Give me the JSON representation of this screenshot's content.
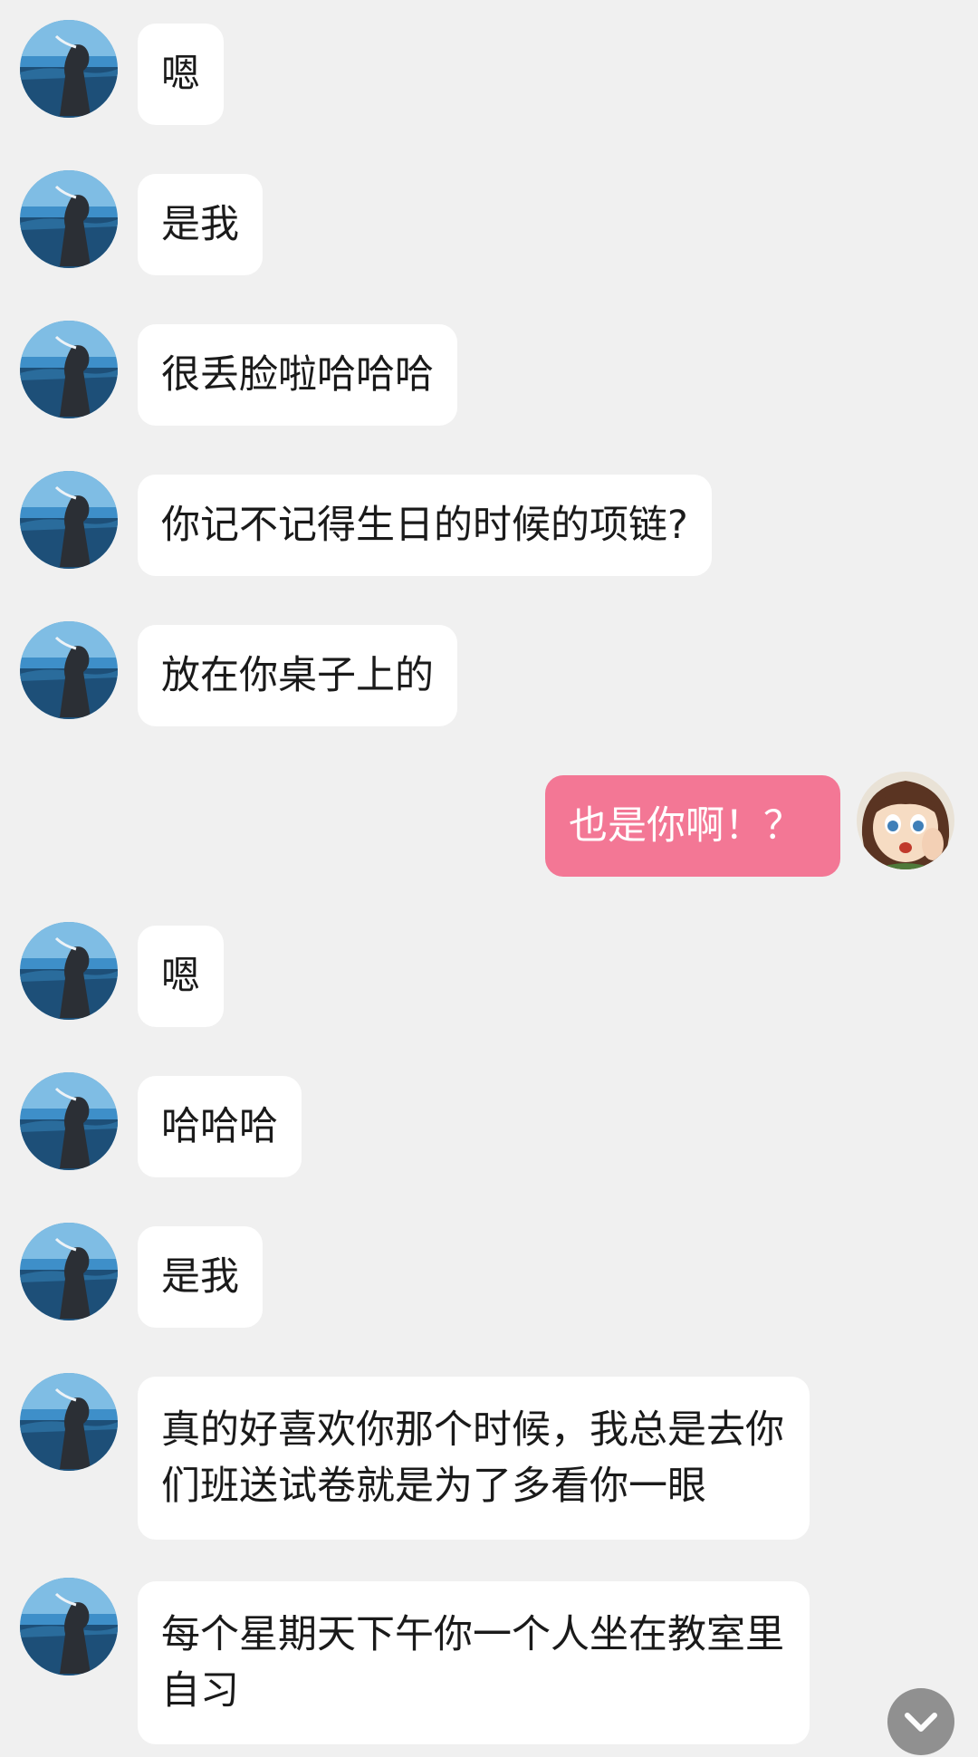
{
  "colors": {
    "background": "#f0f0f0",
    "incoming_bubble": "#ffffff",
    "outgoing_bubble": "#f37795",
    "outgoing_text": "#ffffff",
    "scroll_button": "#888888"
  },
  "messages": [
    {
      "side": "incoming",
      "text": "嗯"
    },
    {
      "side": "incoming",
      "text": "是我"
    },
    {
      "side": "incoming",
      "text": "很丢脸啦哈哈哈"
    },
    {
      "side": "incoming",
      "text": "你记不记得生日的时候的项链?"
    },
    {
      "side": "incoming",
      "text": "放在你桌子上的"
    },
    {
      "side": "outgoing",
      "text": "也是你啊！？"
    },
    {
      "side": "incoming",
      "text": "嗯"
    },
    {
      "side": "incoming",
      "text": "哈哈哈"
    },
    {
      "side": "incoming",
      "text": "是我"
    },
    {
      "side": "incoming",
      "text": "真的好喜欢你那个时候，我总是去你们班送试卷就是为了多看你一眼"
    },
    {
      "side": "incoming",
      "text": "每个星期天下午你一个人坐在教室里自习"
    }
  ],
  "icons": {
    "scroll_down": "chevron-down-icon",
    "incoming_avatar": "seaside-person-avatar",
    "outgoing_avatar": "anime-girl-avatar"
  }
}
